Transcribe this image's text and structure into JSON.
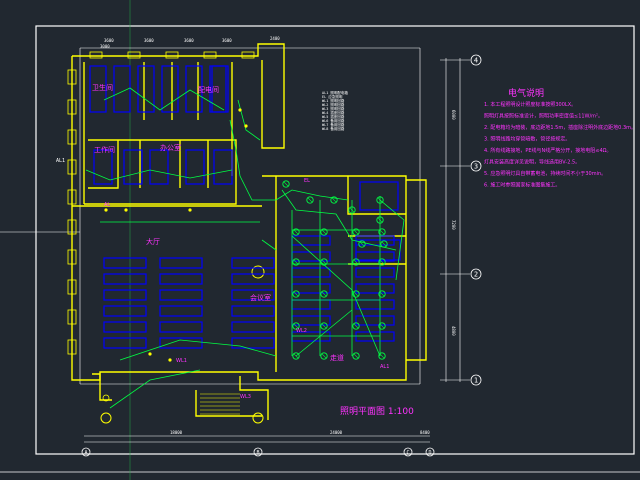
{
  "drawing": {
    "notes_title": "电气说明",
    "notes": [
      "1. 本工程照明设计照度标准按照300LX。",
      "   照明灯具按照标准设计，照明功率密度值≤11W/m²。",
      "2. 配电箱均为暗装，底边距地1.5m，插座除注明外底边距地0.3m。",
      "3. 照明线路均穿管暗敷，管径按规定。",
      "4. 所有线路接地，PE线与N线严格分开，接地电阻≤4Ω。",
      "   灯具安装高度详见说明，导线选用BV-2.5。",
      "5. 应急照明灯具自带蓄电池，持续时间不小于30min。",
      "6. 施工时参照国家标准图集施工。"
    ],
    "plan_title": "照明平面图 1:100",
    "axis_markers": [
      "4",
      "3",
      "2",
      "1",
      "A",
      "B",
      "C",
      "D"
    ],
    "room_labels": [
      "卫生间",
      "配电间",
      "工作间",
      "办公室",
      "大厅",
      "会议室",
      "走道"
    ],
    "dim_texts": [
      "3600",
      "3600",
      "3600",
      "3600",
      "2400",
      "18000",
      "24000",
      "8400",
      "6000",
      "7200",
      "4800",
      "3000"
    ],
    "legend_lines": [
      "AL1 照明配电箱",
      "EL 应急照明",
      "WL1 照明回路",
      "WL2 照明回路",
      "WL3 照明回路",
      "WL4 插座回路",
      "WL5 插座回路",
      "WL6 备用回路",
      "WL7 备用回路",
      "WL8 备用回路"
    ],
    "callouts": [
      "AL",
      "WL1",
      "WL2",
      "WL3",
      "EL",
      "AL1"
    ],
    "small_tag": "AL1"
  },
  "colors": {
    "background": "#212830",
    "wall": "#ffff00",
    "fixture": "#0000ff",
    "wiring": "#00ff44",
    "text_magenta": "#ff33ff",
    "frame": "#ffffff",
    "grid_blue": "#3344ff"
  }
}
